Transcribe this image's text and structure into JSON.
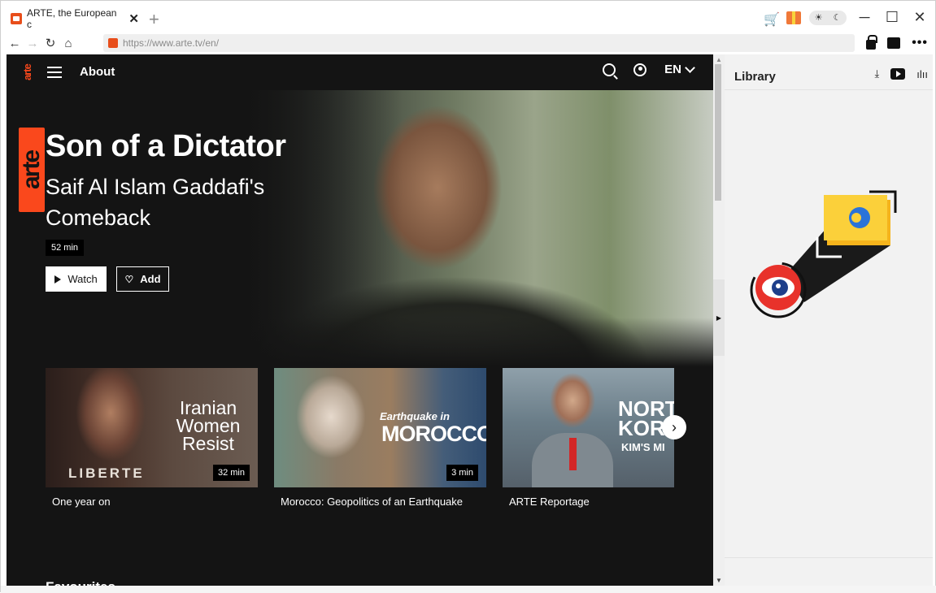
{
  "browser": {
    "tab": {
      "title": "ARTE, the European c",
      "close": "✕"
    },
    "new_tab": "+",
    "url": "https://www.arte.tv/en/",
    "window": {
      "minimize": "─",
      "maximize": "☐",
      "close": "✕"
    },
    "theme_toggle": {
      "light": "☀",
      "dark": "☾"
    },
    "more": "•••"
  },
  "site": {
    "logo_text": "arte",
    "nav": {
      "about": "About",
      "language": "EN"
    },
    "hero": {
      "logo_text": "arte",
      "title": "Son of a Dictator",
      "subtitle": "Saif Al Islam Gaddafi's Comeback",
      "duration": "52 min",
      "watch_label": "Watch",
      "add_label": "Add"
    },
    "cards": [
      {
        "title": "One year on",
        "duration": "32 min",
        "thumb_text": "Iranian Women Resist",
        "thumb_shirt": "LIBERTE"
      },
      {
        "title": "Morocco: Geopolitics of an Earthquake",
        "duration": "3 min",
        "thumb_small": "Earthquake in",
        "thumb_text": "MOROCCO"
      },
      {
        "title": "ARTE Reportage",
        "thumb_text": "NORT KORE",
        "thumb_small": "KIM'S MI"
      }
    ],
    "section_title": "Favourites"
  },
  "library": {
    "title": "Library"
  },
  "colors": {
    "arte_orange": "#fa481c",
    "brand_yellow": "#f5b41c",
    "dark": "#141414"
  }
}
